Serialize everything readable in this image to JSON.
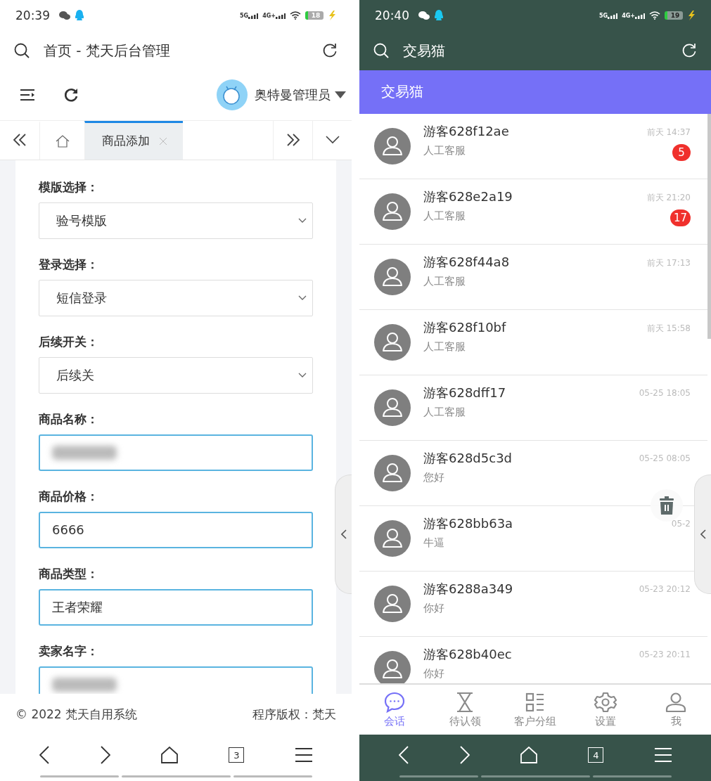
{
  "left": {
    "status_bar": {
      "time": "20:39",
      "networks": [
        "5G",
        "4G+"
      ],
      "battery": "18"
    },
    "title": "首页 - 梵天后台管理",
    "user": "奥特曼管理员",
    "tabs": [
      {
        "kind": "home",
        "selected": false
      },
      {
        "kind": "page",
        "label": "商品添加",
        "selected": true
      }
    ],
    "form": [
      {
        "label": "模版选择：",
        "kind": "select",
        "value": "验号模版"
      },
      {
        "label": "登录选择：",
        "kind": "select",
        "value": "短信登录"
      },
      {
        "label": "后续开关：",
        "kind": "select",
        "value": "后续关"
      },
      {
        "label": "商品名称：",
        "kind": "input",
        "redacted": true
      },
      {
        "label": "商品价格：",
        "kind": "input",
        "value": "6666"
      },
      {
        "label": "商品类型：",
        "kind": "input",
        "value": "王者荣耀"
      },
      {
        "label": "卖家名字：",
        "kind": "input",
        "redacted": true
      }
    ],
    "footer": {
      "copyright": "© 2022 梵天自用系统",
      "rights": "程序版权：梵天"
    },
    "nav": {
      "tab_count": "3"
    }
  },
  "right": {
    "status_bar": {
      "time": "20:40",
      "networks": [
        "5G",
        "4G+"
      ],
      "battery": "19"
    },
    "title": "交易猫",
    "header": "交易猫",
    "conversations": [
      {
        "name": "游客628f12ae",
        "subtitle": "人工客服",
        "time": "前天 14:37",
        "unread": "5"
      },
      {
        "name": "游客628e2a19",
        "subtitle": "人工客服",
        "time": "前天 21:20",
        "unread": "17"
      },
      {
        "name": "游客628f44a8",
        "subtitle": "人工客服",
        "time": "前天 17:13"
      },
      {
        "name": "游客628f10bf",
        "subtitle": "人工客服",
        "time": "前天 15:58"
      },
      {
        "name": "游客628dff17",
        "subtitle": "人工客服",
        "time": "05-25 18:05"
      },
      {
        "name": "游客628d5c3d",
        "subtitle": "您好",
        "time": "05-25 08:05"
      },
      {
        "name": "游客628bb63a",
        "subtitle": "牛逼",
        "time": "05-2"
      },
      {
        "name": "游客6288a349",
        "subtitle": "你好",
        "time": "05-23 20:12"
      },
      {
        "name": "游客628b40ec",
        "subtitle": "你好",
        "time": "05-23 20:11"
      }
    ],
    "bottom_tabs": [
      {
        "kind": "chat",
        "label": "会话",
        "selected": true
      },
      {
        "kind": "hourglass",
        "label": "待认领",
        "selected": false
      },
      {
        "kind": "groups",
        "label": "客户分组",
        "selected": false
      },
      {
        "kind": "gear",
        "label": "设置",
        "selected": false
      },
      {
        "kind": "person",
        "label": "我",
        "selected": false
      }
    ],
    "nav": {
      "tab_count": "4"
    }
  }
}
